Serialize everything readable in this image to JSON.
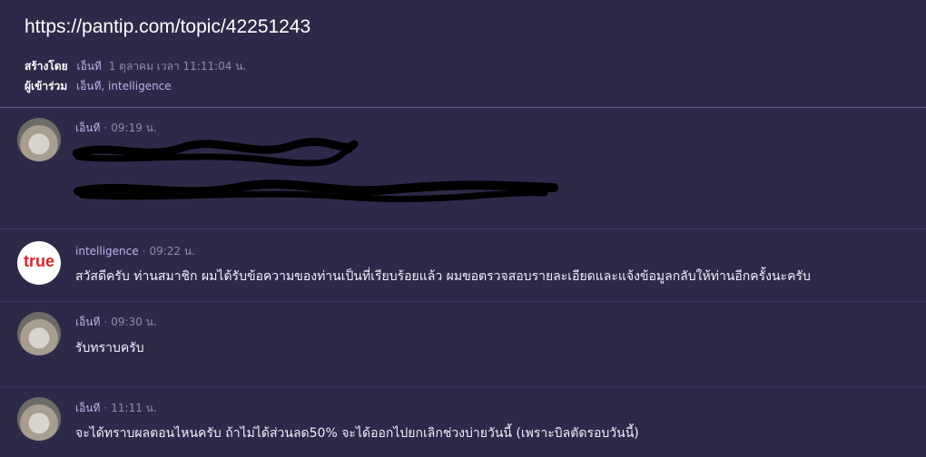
{
  "topic": {
    "url": "https://pantip.com/topic/42251243",
    "created_by_label": "สร้างโดย",
    "created_by_name": "เอ็นที",
    "created_time": "1 ตุลาคม เวลา 11:11:04 น.",
    "members_label": "ผู้เข้าร่วม",
    "members": "เอ็นที, intelligence"
  },
  "messages": [
    {
      "author": "เอ็นที",
      "time": "09:19 น.",
      "avatar": "hedgehog-avatar",
      "lines": []
    },
    {
      "author": "intelligence",
      "time": "09:22 น.",
      "avatar": "true-logo",
      "logo_text": "true",
      "lines": [
        "สวัสดีครับ ท่านสมาชิก ผมได้รับข้อความของท่านเป็นที่เรียบร้อยแล้ว ผมขอตรวจสอบรายละเอียดและแจ้งข้อมูลกลับให้ท่านอีกครั้งนะครับ"
      ]
    },
    {
      "author": "เอ็นที",
      "time": "09:30 น.",
      "avatar": "hedgehog-avatar",
      "lines": [
        "รับทราบครับ"
      ]
    },
    {
      "author": "เอ็นที",
      "time": "11:11 น.",
      "avatar": "hedgehog-avatar",
      "lines": [
        "จะได้ทราบผลตอนไหนครับ ถ้าไม่ได้ส่วนลด50%  จะได้ออกไปยกเลิกช่วงบ่ายวันนี้ (เพราะบิลตัดรอบวันนี้)"
      ]
    }
  ],
  "colors": {
    "background": "#2d2a49",
    "accent": "#b9b2e8",
    "brand_true": "#e0232a"
  }
}
